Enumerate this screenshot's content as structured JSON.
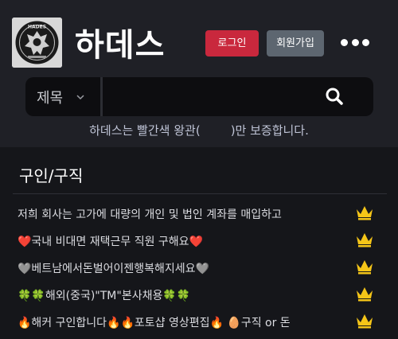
{
  "header": {
    "title": "하데스",
    "logo_text": "HADES",
    "login_label": "로그인",
    "join_label": "회원가입",
    "more_icon": "more-dots-icon"
  },
  "search": {
    "select_value": "제목",
    "placeholder": "",
    "icon": "search-icon"
  },
  "notice": {
    "before": "하데스는 빨간색 왕관(",
    "after": ")만 보증합니다."
  },
  "section": {
    "title": "구인/구직"
  },
  "posts": [
    {
      "title": "저희 회사는 고가에 대량의 개인 및 법인 계좌를 매입하고"
    },
    {
      "title": "❤️국내 비대면 재택근무 직원 구해요❤️"
    },
    {
      "title": "🩶베트남에서돈벌어이젠행복해지세요🩶"
    },
    {
      "title": "🍀🍀해외(중국)\"TM\"본사채용🍀🍀"
    },
    {
      "title": "🔥해커 구인합니다🔥🔥포토샵 영상편집🔥 🥚구직 or 돈"
    }
  ],
  "colors": {
    "accent_red": "#c9283d",
    "crown_gold": "#f5c518",
    "background": "#15161a"
  }
}
